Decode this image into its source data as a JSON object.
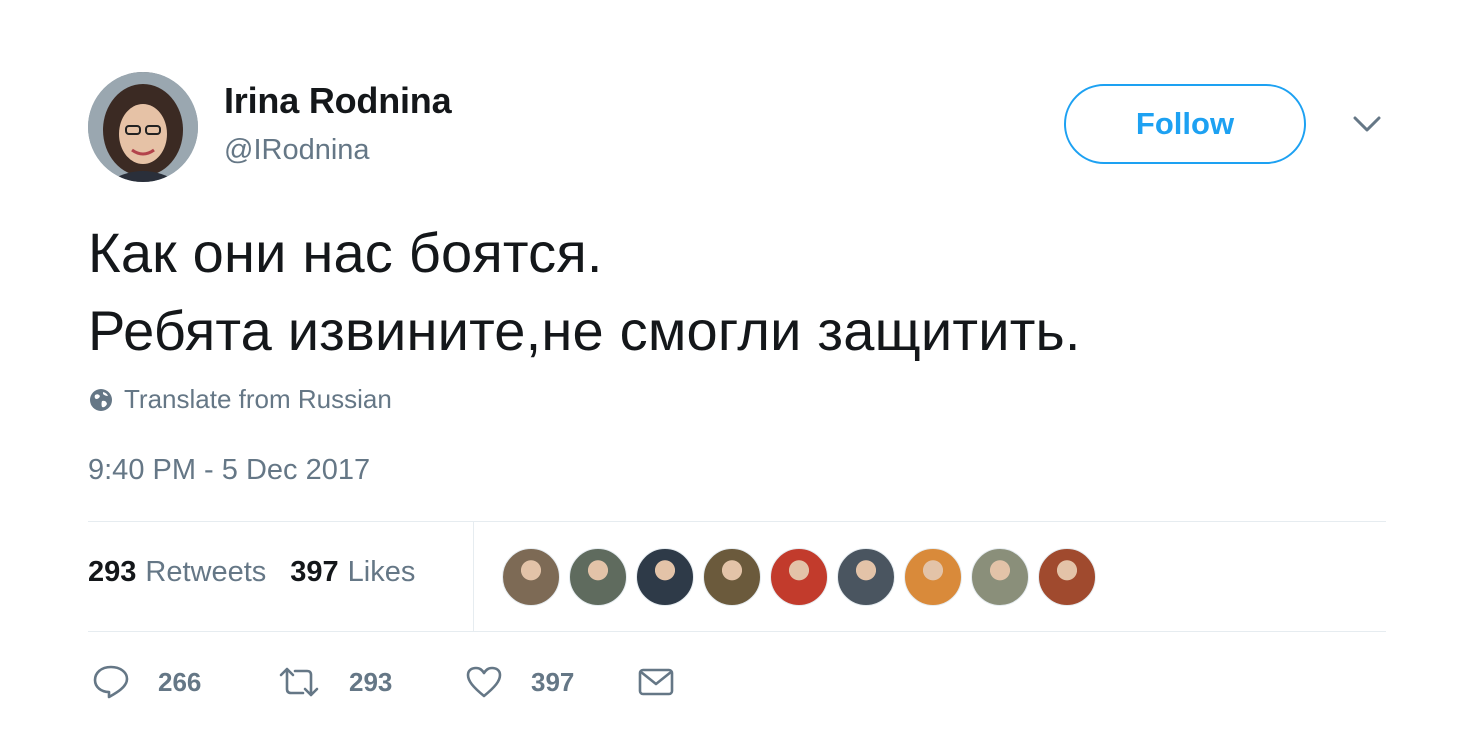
{
  "author": {
    "display_name": "Irina Rodnina",
    "handle": "@IRodnina"
  },
  "header": {
    "follow_label": "Follow",
    "caret_icon": "chevron-down-icon"
  },
  "tweet": {
    "text_lines": [
      "Как они нас боятся.",
      "Ребята извините,не смогли защитить."
    ],
    "translate_label": "Translate from Russian",
    "timestamp": "9:40 PM - 5 Dec 2017"
  },
  "stats": {
    "retweets_count": "293",
    "retweets_label": "Retweets",
    "likes_count": "397",
    "likes_label": "Likes"
  },
  "likers": [
    {
      "name": "liker-avatar-1",
      "color": "#7d6a55"
    },
    {
      "name": "liker-avatar-2",
      "color": "#5f6b5e"
    },
    {
      "name": "liker-avatar-3",
      "color": "#2e3a48"
    },
    {
      "name": "liker-avatar-4",
      "color": "#6b5a3c"
    },
    {
      "name": "liker-avatar-5",
      "color": "#c23b2c"
    },
    {
      "name": "liker-avatar-6",
      "color": "#4a5560"
    },
    {
      "name": "liker-avatar-7",
      "color": "#d98a3a"
    },
    {
      "name": "liker-avatar-8",
      "color": "#8a8f7a"
    },
    {
      "name": "liker-avatar-9",
      "color": "#a04a2e"
    }
  ],
  "actions": {
    "reply_count": "266",
    "retweet_count": "293",
    "like_count": "397"
  },
  "colors": {
    "accent": "#1da1f2",
    "secondary_text": "#657786",
    "primary_text": "#14171a",
    "divider": "#e6ecf0"
  }
}
